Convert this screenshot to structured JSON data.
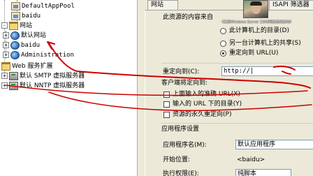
{
  "tree": {
    "pool_items": [
      "DefaultAppPool",
      "baidu"
    ],
    "websites_folder": "网站",
    "sites": [
      "默认网站",
      "baidu",
      "Administration"
    ],
    "web_service_ext": "Web 服务扩展",
    "smtp": "默认 SMTP 虚拟服务器",
    "nntp": "默认 NNTP 虚拟服务器",
    "expander_plus": "+",
    "expander_minus": "-"
  },
  "dialog": {
    "tabs": [
      "网站",
      "ISAPI 筛选器"
    ],
    "content_source_label": "此资源的内容来自",
    "source_options": [
      "此计算机上的目录(D)",
      "另一台计算机上的共享(S)",
      "重定向到 URL(U)"
    ],
    "selected_source_index": 2,
    "redirect_label": "重定向到(C):",
    "redirect_value": "http://|",
    "client_redirect_label": "客户端将定向到:",
    "redirect_options": [
      "上面输入的准确 URL(X)",
      "输入的 URL 下的目录(Y)",
      "资源的永久重定向(P)"
    ],
    "app_settings_label": "应用程序设置",
    "app_name_label": "应用程序名(M):",
    "app_name_value": "默认应用程序",
    "start_pos_label": "开始位置:",
    "start_pos_value": "<baidu>",
    "exec_perm_label": "执行权限(E):",
    "exec_perm_value": "纯脚本"
  },
  "overlay": {
    "caption": "《实例Windows Server 2008网络基础架构》"
  },
  "colors": {
    "annotation": "#cc0000",
    "dialog_bg": "#ece9d8",
    "tree_bg": "#ffffff"
  }
}
